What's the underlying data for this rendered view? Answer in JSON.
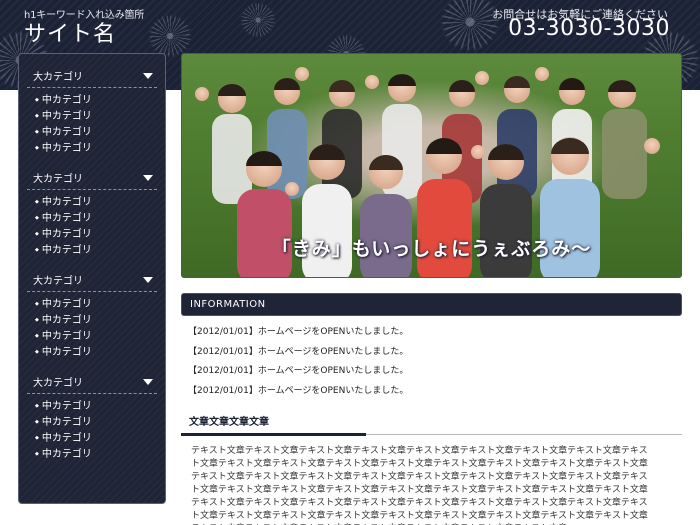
{
  "header": {
    "tagline": "h1キーワード入れ込み箇所",
    "site_name": "サイト名",
    "contact_label": "お問合せはお気軽にご連絡ください",
    "phone": "03-3030-3030"
  },
  "sidebar": {
    "categories": [
      {
        "label": "大カテゴリ",
        "items": [
          "中カテゴリ",
          "中カテゴリ",
          "中カテゴリ",
          "中カテゴリ"
        ]
      },
      {
        "label": "大カテゴリ",
        "items": [
          "中カテゴリ",
          "中カテゴリ",
          "中カテゴリ",
          "中カテゴリ"
        ]
      },
      {
        "label": "大カテゴリ",
        "items": [
          "中カテゴリ",
          "中カテゴリ",
          "中カテゴリ",
          "中カテゴリ"
        ]
      },
      {
        "label": "大カテゴリ",
        "items": [
          "中カテゴリ",
          "中カテゴリ",
          "中カテゴリ",
          "中カテゴリ"
        ]
      }
    ]
  },
  "hero": {
    "caption": "「きみ」もいっしょにうぇぶろみ〜"
  },
  "info": {
    "title": "INFORMATION",
    "news": [
      "【2012/01/01】ホームページをOPENいたしました。",
      "【2012/01/01】ホームページをOPENいたしました。",
      "【2012/01/01】ホームページをOPENいたしました。",
      "【2012/01/01】ホームページをOPENいたしました。"
    ]
  },
  "section": {
    "title": "文章文章文章文章",
    "body": "テキスト文章テキスト文章テキスト文章テキスト文章テキスト文章テキスト文章テキスト文章テキスト文章テキスト文章テキスト文章テキスト文章テキスト文章テキスト文章テキスト文章テキスト文章テキスト文章テキスト文章テキスト文章テキスト文章テキスト文章テキスト文章テキスト文章テキスト文章テキスト文章テキスト文章テキスト文章テキスト文章テキスト文章テキスト文章テキスト文章テキスト文章テキスト文章テキスト文章テキスト文章テキスト文章テキスト文章テキスト文章テキスト文章テキスト文章テキスト文章テキスト文章テキスト文章テキスト文章テキスト文章テキスト文章テキスト文章テキスト文章テキスト文章テキスト文章テキスト文章テキスト文章テキスト文章テキスト文章テキスト文章テキスト文章テキスト文章テキスト文章テキスト文章"
  },
  "colors": {
    "header_bg": "#1c2236",
    "sidebar_bg": "#1f2536",
    "accent": "#1c2236"
  }
}
